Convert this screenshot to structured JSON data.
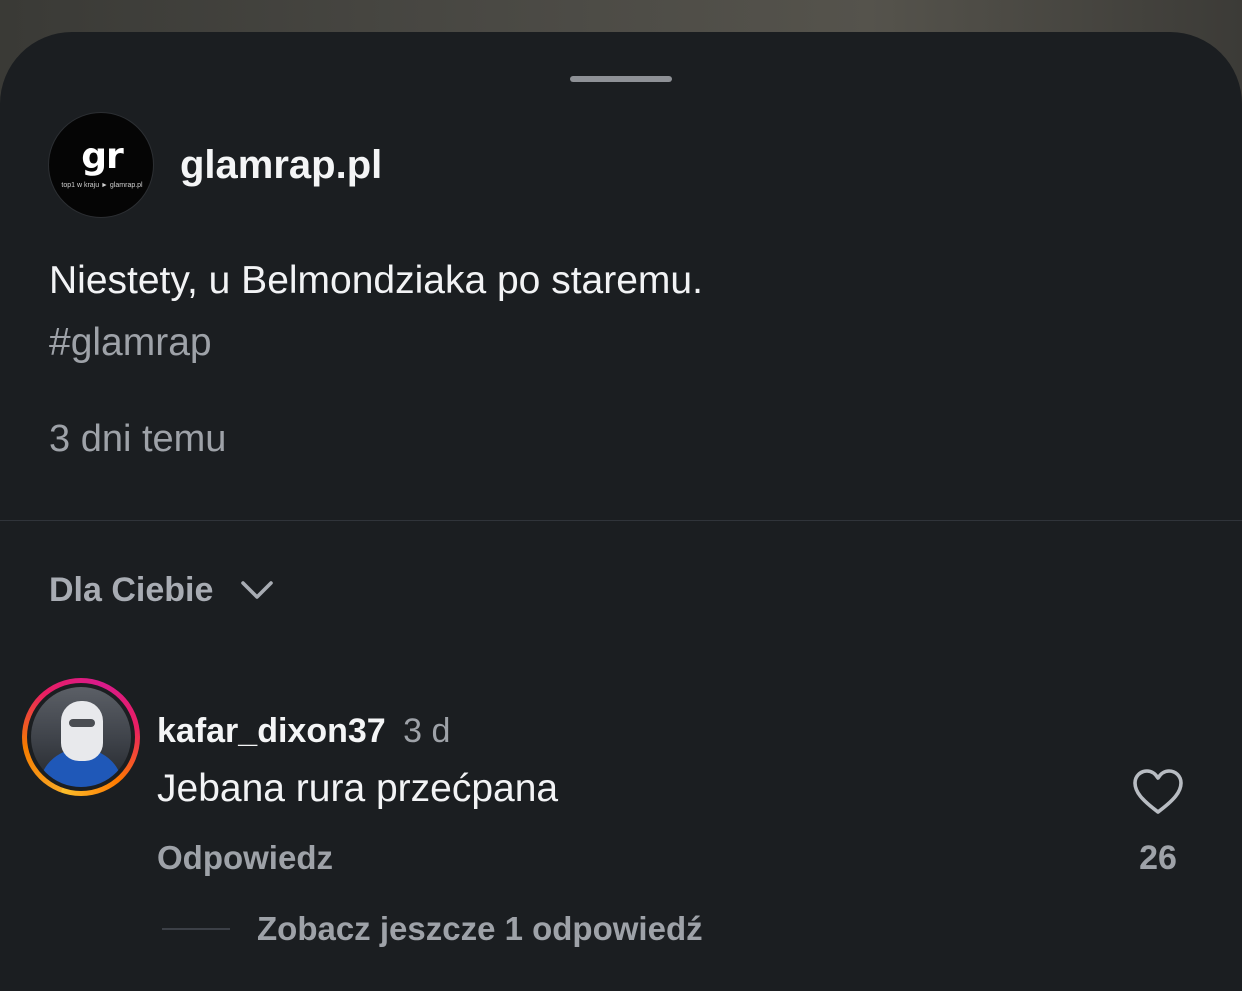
{
  "post": {
    "username": "glamrap.pl",
    "avatar": {
      "logo_text": "gr",
      "logo_subtext": "top1 w kraju ► glamrap.pl"
    },
    "caption": "Niestety, u Belmondziaka po staremu.",
    "hashtag": "#glamrap",
    "timestamp": "3 dni temu"
  },
  "comments_section": {
    "sort_label": "Dla Ciebie",
    "sort_icon": "chevron-down-icon"
  },
  "comment": {
    "username": "kafar_dixon37",
    "time": "3 d",
    "text": "Jebana rura przećpana",
    "reply_label": "Odpowiedz",
    "like_icon": "heart-icon",
    "like_count": "26",
    "view_replies_label": "Zobacz jeszcze 1 odpowiedź"
  },
  "colors": {
    "sheet_background": "#1b1e21",
    "primary_text": "#f2f3f5",
    "secondary_text": "#9ea2a8",
    "story_ring": [
      "#f9a825",
      "#e91e63",
      "#d81b8c"
    ]
  }
}
